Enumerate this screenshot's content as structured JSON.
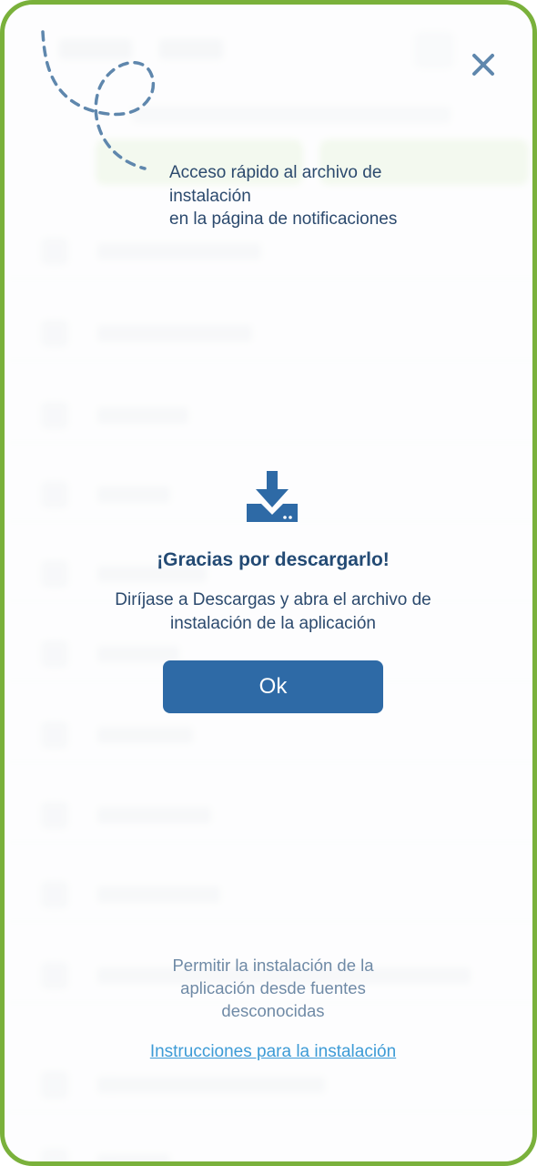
{
  "dialog": {
    "hint": "Acceso rápido al archivo de\ninstalación\nen la página de notificaciones",
    "title": "¡Gracias por descargarlo!",
    "description": "Diríjase a Descargas y abra el archivo de\ninstalación de la aplicación",
    "ok_label": "Ok",
    "permit_text": "Permitir la instalación de la\naplicación desde fuentes\ndesconocidas",
    "instructions_link": "Instrucciones para la instalación"
  },
  "icons": {
    "close": "close-icon",
    "download": "download-icon",
    "decoration": "dashed-swirl"
  },
  "colors": {
    "frame_border": "#7ab13b",
    "primary": "#2e6aa6",
    "title": "#234a74",
    "text": "#2c4a6e",
    "muted": "#6f8aa6",
    "link": "#3d9bd6",
    "close": "#5f87ad"
  }
}
